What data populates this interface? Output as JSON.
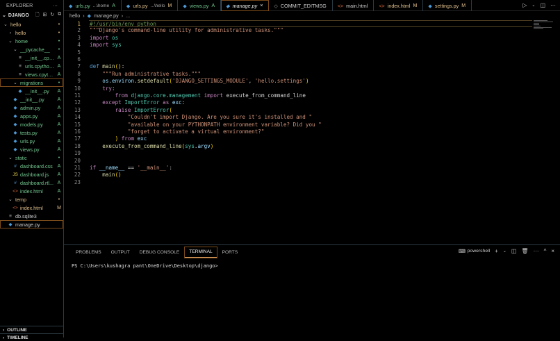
{
  "sidebar": {
    "title": "EXPLORER",
    "more": "···",
    "root": "DJANGO",
    "items": [
      {
        "label": "hello",
        "depth": 0,
        "type": "folder-open",
        "status": "•",
        "color": "#e2c08d"
      },
      {
        "label": "hello",
        "depth": 1,
        "type": "folder",
        "status": "•",
        "color": "#e2c08d"
      },
      {
        "label": "home",
        "depth": 1,
        "type": "folder-open",
        "status": "•",
        "color": "#73c991"
      },
      {
        "label": "__pycache__",
        "depth": 2,
        "type": "folder-open",
        "status": "•",
        "color": "#73c991"
      },
      {
        "label": "__init__.cpyt...",
        "depth": 3,
        "type": "file",
        "status": "A",
        "color": "#73c991"
      },
      {
        "label": "urls.cpython...",
        "depth": 3,
        "type": "file",
        "status": "A",
        "color": "#73c991"
      },
      {
        "label": "views.cpyth...",
        "depth": 3,
        "type": "file",
        "status": "A",
        "color": "#73c991"
      },
      {
        "label": "migrations",
        "depth": 2,
        "type": "folder-open",
        "status": "•",
        "color": "#73c991",
        "selected": true
      },
      {
        "label": "__init__.py",
        "depth": 3,
        "type": "python",
        "status": "A",
        "color": "#73c991"
      },
      {
        "label": "__init__.py",
        "depth": 2,
        "type": "python",
        "status": "A",
        "color": "#73c991"
      },
      {
        "label": "admin.py",
        "depth": 2,
        "type": "python",
        "status": "A",
        "color": "#73c991"
      },
      {
        "label": "apps.py",
        "depth": 2,
        "type": "python",
        "status": "A",
        "color": "#73c991"
      },
      {
        "label": "models.py",
        "depth": 2,
        "type": "python",
        "status": "A",
        "color": "#73c991"
      },
      {
        "label": "tests.py",
        "depth": 2,
        "type": "python",
        "status": "A",
        "color": "#73c991"
      },
      {
        "label": "urls.py",
        "depth": 2,
        "type": "python",
        "status": "A",
        "color": "#73c991"
      },
      {
        "label": "views.py",
        "depth": 2,
        "type": "python",
        "status": "A",
        "color": "#73c991"
      },
      {
        "label": "static",
        "depth": 1,
        "type": "folder-open",
        "status": "•",
        "color": "#73c991"
      },
      {
        "label": "dashboard.css",
        "depth": 2,
        "type": "css",
        "status": "A",
        "color": "#73c991"
      },
      {
        "label": "dashboard.js",
        "depth": 2,
        "type": "js",
        "status": "A",
        "color": "#73c991"
      },
      {
        "label": "dashboard.rtl...",
        "depth": 2,
        "type": "css",
        "status": "A",
        "color": "#73c991"
      },
      {
        "label": "index.html",
        "depth": 2,
        "type": "html",
        "status": "A",
        "color": "#73c991"
      },
      {
        "label": "temp",
        "depth": 1,
        "type": "folder-open",
        "status": "•",
        "color": "#e2c08d"
      },
      {
        "label": "index.html",
        "depth": 2,
        "type": "html",
        "status": "M",
        "color": "#e2c08d"
      },
      {
        "label": "db.sqlite3",
        "depth": 1,
        "type": "file",
        "status": "",
        "color": "#cccccc"
      },
      {
        "label": "manage.py",
        "depth": 1,
        "type": "python",
        "status": "",
        "color": "#cccccc",
        "selected": true
      }
    ],
    "footer": [
      "OUTLINE",
      "TIMELINE"
    ]
  },
  "tabs": [
    {
      "label": "urls.py",
      "desc": "...\\home",
      "status": "A",
      "type": "python",
      "color": "#73c991"
    },
    {
      "label": "urls.py",
      "desc": "...\\hello",
      "status": "M",
      "type": "python",
      "color": "#e2c08d"
    },
    {
      "label": "views.py",
      "desc": "",
      "status": "A",
      "type": "python",
      "color": "#73c991"
    },
    {
      "label": "manage.py",
      "desc": "",
      "status": "×",
      "type": "python",
      "color": "#eeeeee",
      "active": true
    },
    {
      "label": "COMMIT_EDITMSG",
      "desc": "",
      "status": "",
      "type": "git",
      "color": "#cccccc"
    },
    {
      "label": "main.html",
      "desc": "",
      "status": "",
      "type": "html",
      "color": "#cccccc"
    },
    {
      "label": "index.html",
      "desc": "",
      "status": "M",
      "type": "html",
      "color": "#e2c08d"
    },
    {
      "label": "settings.py",
      "desc": "",
      "status": "M",
      "type": "python",
      "color": "#e2c08d"
    }
  ],
  "breadcrumb": [
    "hello",
    "manage.py",
    "..."
  ],
  "code": [
    [
      [
        "#!/usr/bin/env python",
        "cm"
      ]
    ],
    [
      [
        "\"\"\"Django's command-line utility for administrative tasks.\"\"\"",
        "str"
      ]
    ],
    [
      [
        "import",
        "kw"
      ],
      [
        " os",
        "cls"
      ]
    ],
    [
      [
        "import",
        "kw"
      ],
      [
        " sys",
        "cls"
      ]
    ],
    [],
    [],
    [
      [
        "def",
        "df"
      ],
      [
        " main",
        "fn"
      ],
      [
        "()",
        "br"
      ],
      [
        ":",
        "pl"
      ]
    ],
    [
      [
        "    \"\"\"Run administrative tasks.\"\"\"",
        "str"
      ]
    ],
    [
      [
        "    os",
        "var"
      ],
      [
        ".",
        "pl"
      ],
      [
        "environ",
        "var"
      ],
      [
        ".",
        "pl"
      ],
      [
        "setdefault",
        "fn"
      ],
      [
        "(",
        "br"
      ],
      [
        "'DJANGO_SETTINGS_MODULE'",
        "str"
      ],
      [
        ", ",
        "pl"
      ],
      [
        "'hello.settings'",
        "str"
      ],
      [
        ")",
        "br"
      ]
    ],
    [
      [
        "    try",
        "kw"
      ],
      [
        ":",
        "pl"
      ]
    ],
    [
      [
        "        from",
        "kw"
      ],
      [
        " django",
        "cls"
      ],
      [
        ".",
        "pl"
      ],
      [
        "core",
        "cls"
      ],
      [
        ".",
        "pl"
      ],
      [
        "management",
        "cls"
      ],
      [
        " import",
        "kw"
      ],
      [
        " execute_from_command_line",
        "pl"
      ]
    ],
    [
      [
        "    except",
        "kw"
      ],
      [
        " ImportError",
        "cls"
      ],
      [
        " as",
        "kw"
      ],
      [
        " exc",
        "var"
      ],
      [
        ":",
        "pl"
      ]
    ],
    [
      [
        "        raise",
        "kw"
      ],
      [
        " ImportError",
        "cls"
      ],
      [
        "(",
        "br"
      ]
    ],
    [
      [
        "            \"Couldn't import Django. Are you sure it's installed and \"",
        "str"
      ]
    ],
    [
      [
        "            \"available on your PYTHONPATH environment variable? Did you \"",
        "str"
      ]
    ],
    [
      [
        "            \"forget to activate a virtual environment?\"",
        "str"
      ]
    ],
    [
      [
        "        )",
        "br"
      ],
      [
        " from",
        "kw"
      ],
      [
        " exc",
        "var"
      ]
    ],
    [
      [
        "    execute_from_command_line",
        "fn"
      ],
      [
        "(",
        "br"
      ],
      [
        "sys",
        "cls"
      ],
      [
        ".",
        "pl"
      ],
      [
        "argv",
        "var"
      ],
      [
        ")",
        "br"
      ]
    ],
    [],
    [],
    [
      [
        "if",
        "kw"
      ],
      [
        " __name__",
        "var"
      ],
      [
        " == ",
        "pl"
      ],
      [
        "'__main__'",
        "str"
      ],
      [
        ":",
        "pl"
      ]
    ],
    [
      [
        "    main",
        "fn"
      ],
      [
        "()",
        "br"
      ]
    ],
    []
  ],
  "panel": {
    "tabs": [
      "PROBLEMS",
      "OUTPUT",
      "DEBUG CONSOLE",
      "TERMINAL",
      "PORTS"
    ],
    "active_tab": 3,
    "shell": "powershell",
    "terminal": "PS C:\\Users\\kushagra pant\\OneDrive\\Desktop\\django>"
  },
  "icons": {
    "python": "◆",
    "folder": "›",
    "folder-open": "⌄",
    "file": "≡",
    "css": "#",
    "js": "JS",
    "html": "<>",
    "git": "◇"
  },
  "colors": {
    "python": "#4e9ad6",
    "css": "#4e9ad6",
    "js": "#e8d44d",
    "html": "#e06c3c",
    "file": "#bbbbbb",
    "git": "#aaaaaa",
    "folder": "#cccccc",
    "folder-open": "#cccccc"
  }
}
